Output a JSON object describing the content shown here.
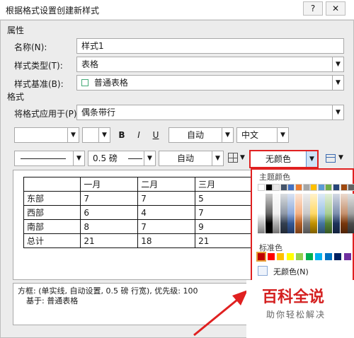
{
  "window": {
    "title": "根据格式设置创建新样式",
    "help_label": "?",
    "close_label": "✕"
  },
  "properties": {
    "section_label": "属性",
    "name_label": "名称(N):",
    "name_value": "样式1",
    "type_label": "样式类型(T):",
    "type_value": "表格",
    "base_label": "样式基准(B):",
    "base_value": "普通表格"
  },
  "format": {
    "section_label": "格式",
    "apply_label": "将格式应用于(P):",
    "apply_value": "偶条带行",
    "bold_label": "B",
    "italic_label": "I",
    "underline_label": "U",
    "font_color_value": "自动",
    "script_value": "中文",
    "border_weight_value": "0.5 磅",
    "border_color_value": "自动",
    "shading_value": "无颜色"
  },
  "preview_table": {
    "rows": [
      [
        "",
        "一月",
        "二月",
        "三月"
      ],
      [
        "东部",
        "7",
        "7",
        "5"
      ],
      [
        "西部",
        "6",
        "4",
        "7"
      ],
      [
        "南部",
        "8",
        "7",
        "9"
      ],
      [
        "总计",
        "21",
        "18",
        "21"
      ]
    ]
  },
  "description": {
    "line1": "方框: (单实线, 自动设置, 0.5 磅 行宽), 优先级: 100",
    "line2": "基于: 普通表格"
  },
  "color_picker": {
    "theme_label": "主题颜色",
    "standard_label": "标准色",
    "no_color_label": "无颜色(N)",
    "theme_top": [
      "#ffffff",
      "#000000",
      "#e7e6e6",
      "#44546a",
      "#4472c4",
      "#ed7d31",
      "#a5a5a5",
      "#ffc000",
      "#5b9bd5",
      "#70ad47",
      "#264478",
      "#9e480e",
      "#636363"
    ],
    "standard": [
      "#c00000",
      "#ff0000",
      "#ffc000",
      "#ffff00",
      "#92d050",
      "#00b050",
      "#00b0f0",
      "#0070c0",
      "#002060",
      "#7030a0"
    ]
  },
  "watermark": {
    "title": "百科全说",
    "subtitle": "助你轻松解决"
  }
}
